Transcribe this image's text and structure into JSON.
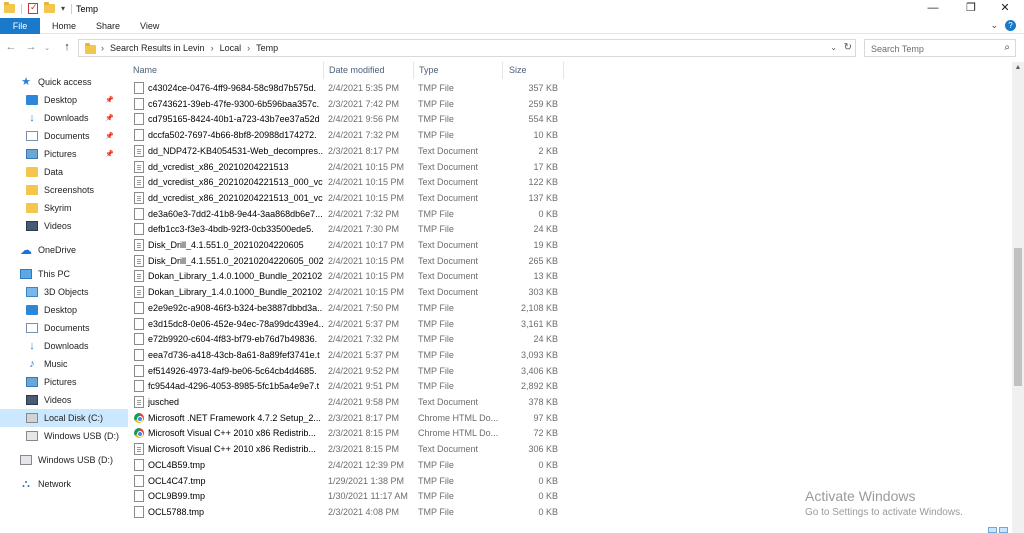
{
  "window": {
    "title": "Temp"
  },
  "ribbon": {
    "tabs": [
      "File",
      "Home",
      "Share",
      "View"
    ]
  },
  "address": {
    "crumbs": [
      "Search Results in Levin",
      "Local",
      "Temp"
    ],
    "search_placeholder": "Search Temp"
  },
  "nav": {
    "items": [
      {
        "label": "Quick access",
        "icon": "star-icon",
        "pinned": false
      },
      {
        "label": "Desktop",
        "icon": "desktop-icon",
        "pinned": true
      },
      {
        "label": "Downloads",
        "icon": "downloads-icon",
        "pinned": true
      },
      {
        "label": "Documents",
        "icon": "documents-icon",
        "pinned": true
      },
      {
        "label": "Pictures",
        "icon": "pictures-icon",
        "pinned": true
      },
      {
        "label": "Data",
        "icon": "folder-icon",
        "pinned": false
      },
      {
        "label": "Screenshots",
        "icon": "folder-icon",
        "pinned": false
      },
      {
        "label": "Skyrim",
        "icon": "folder-icon",
        "pinned": false
      },
      {
        "label": "Videos",
        "icon": "videos-icon",
        "pinned": false
      },
      {
        "label": "OneDrive",
        "icon": "cloud-icon",
        "pinned": false
      },
      {
        "label": "This PC",
        "icon": "computer-icon",
        "pinned": false
      },
      {
        "label": "3D Objects",
        "icon": "3d-objects-icon",
        "pinned": false
      },
      {
        "label": "Desktop",
        "icon": "desktop-icon",
        "pinned": false
      },
      {
        "label": "Documents",
        "icon": "documents-icon",
        "pinned": false
      },
      {
        "label": "Downloads",
        "icon": "downloads-icon",
        "pinned": false
      },
      {
        "label": "Music",
        "icon": "music-icon",
        "pinned": false
      },
      {
        "label": "Pictures",
        "icon": "pictures-icon",
        "pinned": false
      },
      {
        "label": "Videos",
        "icon": "videos-icon",
        "pinned": false
      },
      {
        "label": "Local Disk (C:)",
        "icon": "drive-icon",
        "pinned": false,
        "selected": true
      },
      {
        "label": "Windows USB (D:)",
        "icon": "usb-drive-icon",
        "pinned": false
      },
      {
        "label": "Windows USB (D:)",
        "icon": "usb-drive-icon",
        "pinned": false
      },
      {
        "label": "Network",
        "icon": "network-icon",
        "pinned": false
      }
    ]
  },
  "columns": {
    "name": "Name",
    "date": "Date modified",
    "type": "Type",
    "size": "Size"
  },
  "files": [
    {
      "name": "c43024ce-0476-4ff9-9684-58c98d7b575d.",
      "date": "2/4/2021 5:35 PM",
      "type": "TMP File",
      "size": "357 KB",
      "icon": "file"
    },
    {
      "name": "c6743621-39eb-47fe-9300-6b596baa357c.",
      "date": "2/3/2021 7:42 PM",
      "type": "TMP File",
      "size": "259 KB",
      "icon": "file"
    },
    {
      "name": "cd795165-8424-40b1-a723-43b7ee37a52d",
      "date": "2/4/2021 9:56 PM",
      "type": "TMP File",
      "size": "554 KB",
      "icon": "file"
    },
    {
      "name": "dccfa502-7697-4b66-8bf8-20988d174272.",
      "date": "2/4/2021 7:32 PM",
      "type": "TMP File",
      "size": "10 KB",
      "icon": "file"
    },
    {
      "name": "dd_NDP472-KB4054531-Web_decompres...",
      "date": "2/3/2021 8:17 PM",
      "type": "Text Document",
      "size": "2 KB",
      "icon": "text"
    },
    {
      "name": "dd_vcredist_x86_20210204221513",
      "date": "2/4/2021 10:15 PM",
      "type": "Text Document",
      "size": "17 KB",
      "icon": "text"
    },
    {
      "name": "dd_vcredist_x86_20210204221513_000_vc...",
      "date": "2/4/2021 10:15 PM",
      "type": "Text Document",
      "size": "122 KB",
      "icon": "text"
    },
    {
      "name": "dd_vcredist_x86_20210204221513_001_vc...",
      "date": "2/4/2021 10:15 PM",
      "type": "Text Document",
      "size": "137 KB",
      "icon": "text"
    },
    {
      "name": "de3a60e3-7dd2-41b8-9e44-3aa868db6e7...",
      "date": "2/4/2021 7:32 PM",
      "type": "TMP File",
      "size": "0 KB",
      "icon": "file"
    },
    {
      "name": "defb1cc3-f3e3-4bdb-92f3-0cb33500ede5.",
      "date": "2/4/2021 7:30 PM",
      "type": "TMP File",
      "size": "24 KB",
      "icon": "file"
    },
    {
      "name": "Disk_Drill_4.1.551.0_20210204220605",
      "date": "2/4/2021 10:17 PM",
      "type": "Text Document",
      "size": "19 KB",
      "icon": "text"
    },
    {
      "name": "Disk_Drill_4.1.551.0_20210204220605_002_...",
      "date": "2/4/2021 10:15 PM",
      "type": "Text Document",
      "size": "265 KB",
      "icon": "text"
    },
    {
      "name": "Dokan_Library_1.4.0.1000_Bundle_202102...",
      "date": "2/4/2021 10:15 PM",
      "type": "Text Document",
      "size": "13 KB",
      "icon": "text"
    },
    {
      "name": "Dokan_Library_1.4.0.1000_Bundle_202102...",
      "date": "2/4/2021 10:15 PM",
      "type": "Text Document",
      "size": "303 KB",
      "icon": "text"
    },
    {
      "name": "e2e9e92c-a908-46f3-b324-be3887dbbd3a...",
      "date": "2/4/2021 7:50 PM",
      "type": "TMP File",
      "size": "2,108 KB",
      "icon": "file"
    },
    {
      "name": "e3d15dc8-0e06-452e-94ec-78a99dc439e4...",
      "date": "2/4/2021 5:37 PM",
      "type": "TMP File",
      "size": "3,161 KB",
      "icon": "file"
    },
    {
      "name": "e72b9920-c604-4f83-bf79-eb76d7b49836.",
      "date": "2/4/2021 7:32 PM",
      "type": "TMP File",
      "size": "24 KB",
      "icon": "file"
    },
    {
      "name": "eea7d736-a418-43cb-8a61-8a89fef3741e.t",
      "date": "2/4/2021 5:37 PM",
      "type": "TMP File",
      "size": "3,093 KB",
      "icon": "file"
    },
    {
      "name": "ef514926-4973-4af9-be06-5c64cb4d4685.",
      "date": "2/4/2021 9:52 PM",
      "type": "TMP File",
      "size": "3,406 KB",
      "icon": "file"
    },
    {
      "name": "fc9544ad-4296-4053-8985-5fc1b5a4e9e7.t",
      "date": "2/4/2021 9:51 PM",
      "type": "TMP File",
      "size": "2,892 KB",
      "icon": "file"
    },
    {
      "name": "jusched",
      "date": "2/4/2021 9:58 PM",
      "type": "Text Document",
      "size": "378 KB",
      "icon": "text"
    },
    {
      "name": "Microsoft .NET Framework 4.7.2 Setup_2...",
      "date": "2/3/2021 8:17 PM",
      "type": "Chrome HTML Do...",
      "size": "97 KB",
      "icon": "chrome"
    },
    {
      "name": "Microsoft Visual C++ 2010  x86 Redistrib...",
      "date": "2/3/2021 8:15 PM",
      "type": "Chrome HTML Do...",
      "size": "72 KB",
      "icon": "chrome"
    },
    {
      "name": "Microsoft Visual C++ 2010  x86 Redistrib...",
      "date": "2/3/2021 8:15 PM",
      "type": "Text Document",
      "size": "306 KB",
      "icon": "text"
    },
    {
      "name": "OCL4B59.tmp",
      "date": "2/4/2021 12:39 PM",
      "type": "TMP File",
      "size": "0 KB",
      "icon": "file"
    },
    {
      "name": "OCL4C47.tmp",
      "date": "1/29/2021 1:38 PM",
      "type": "TMP File",
      "size": "0 KB",
      "icon": "file"
    },
    {
      "name": "OCL9B99.tmp",
      "date": "1/30/2021 11:17 AM",
      "type": "TMP File",
      "size": "0 KB",
      "icon": "file"
    },
    {
      "name": "OCL5788.tmp",
      "date": "2/3/2021 4:08 PM",
      "type": "TMP File",
      "size": "0 KB",
      "icon": "file"
    }
  ],
  "watermark": {
    "line1": "Activate Windows",
    "line2": "Go to Settings to activate Windows."
  }
}
